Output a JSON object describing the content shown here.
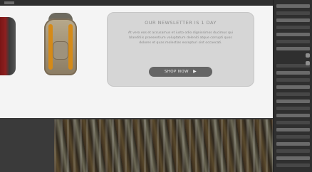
{
  "promo_card": {
    "title": "OUR NEWSLETTER IS 1 DAY",
    "body": "At vero eos et accusamus et iusto odio dignissimos ducimus qui blanditiis praesentium voluptatum deleniti atque corrupti quos dolores et quas molestias excepturi sint occaecati.",
    "button_label": "SHOP NOW",
    "button_icon": "play-arrow-icon"
  },
  "products": [
    {
      "name": "left-backpack-image",
      "color": "#8d1f1f"
    },
    {
      "name": "right-backpack-image",
      "color": "#b7a98c"
    }
  ],
  "panel": {
    "name": "layers-panel"
  },
  "colors": {
    "canvas_bg": "#f4f4f4",
    "card_bg": "#d6d6d6",
    "button_bg": "#656565",
    "panel_bg": "#2f2f2f"
  }
}
